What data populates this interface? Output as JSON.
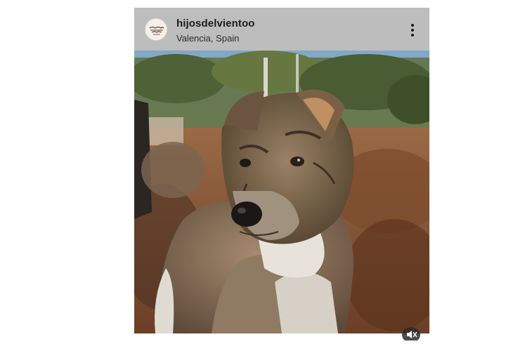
{
  "post": {
    "username": "hijosdelvientoo",
    "location": "Valencia, Spain",
    "avatar_icon": "profile-logo-icon",
    "more_icon": "more-vertical-icon",
    "mute_icon": "muted-speaker-icon"
  }
}
